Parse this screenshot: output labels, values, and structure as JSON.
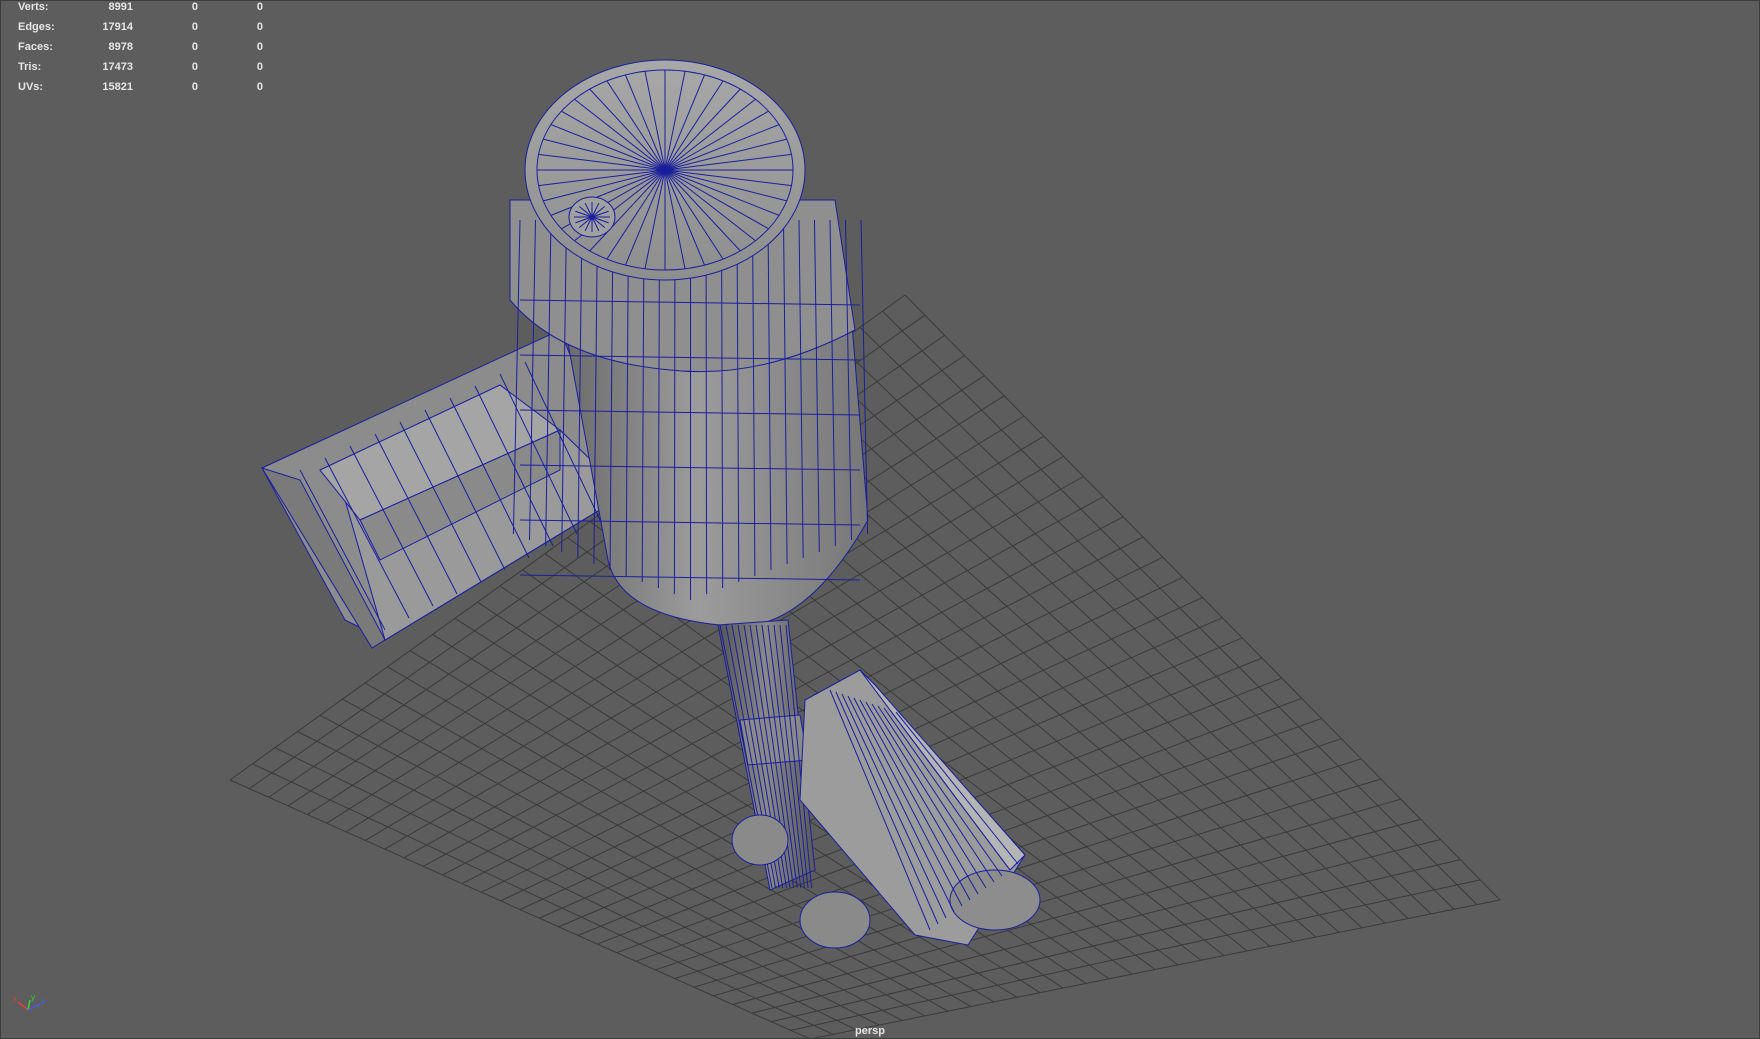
{
  "hud": {
    "rows": [
      {
        "label": "Verts:",
        "values": [
          "8991",
          "0",
          "0"
        ]
      },
      {
        "label": "Edges:",
        "values": [
          "17914",
          "0",
          "0"
        ]
      },
      {
        "label": "Faces:",
        "values": [
          "8978",
          "0",
          "0"
        ]
      },
      {
        "label": "Tris:",
        "values": [
          "17473",
          "0",
          "0"
        ]
      },
      {
        "label": "UVs:",
        "values": [
          "15821",
          "0",
          "0"
        ]
      }
    ]
  },
  "viewport": {
    "camera_label": "persp",
    "background_color": "#5d5d5d",
    "grid_color": "#3a3a3a",
    "wireframe_color": "#1a1f9c",
    "shaded_color": "#9a9a9a"
  },
  "axis_gizmo": {
    "x_label": "x",
    "y_label": "y",
    "z_label": "z"
  },
  "icons": [
    "axis-gizmo-icon"
  ]
}
